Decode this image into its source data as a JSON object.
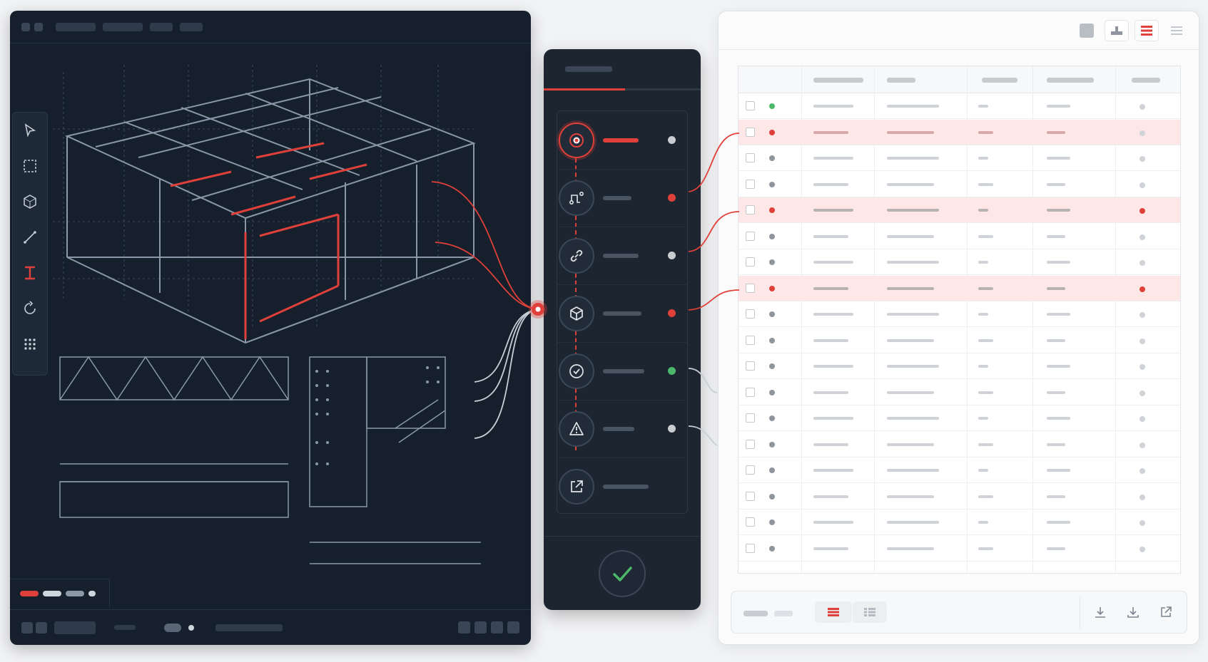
{
  "colors": {
    "accent": "#e0403a",
    "success": "#4cb86a",
    "neutral_dot": "#9aa1a9",
    "dark_bg": "#16202d",
    "panel_bg": "#1c2530"
  },
  "cad_window": {
    "tools": [
      {
        "name": "select-pointer-icon",
        "active": false
      },
      {
        "name": "marquee-select-icon",
        "active": false
      },
      {
        "name": "3d-model-icon",
        "active": false
      },
      {
        "name": "measure-line-icon",
        "active": false
      },
      {
        "name": "i-beam-member-icon",
        "active": true
      },
      {
        "name": "rotate-icon",
        "active": false
      },
      {
        "name": "grid-points-icon",
        "active": false
      }
    ]
  },
  "validation_panel": {
    "progress_fraction": 0.52,
    "steps": [
      {
        "icon": "target-icon",
        "status": "neutral",
        "active": true
      },
      {
        "icon": "path-route-icon",
        "status": "error",
        "active": false
      },
      {
        "icon": "link-icon",
        "status": "neutral",
        "active": false
      },
      {
        "icon": "cube-icon",
        "status": "error",
        "active": false
      },
      {
        "icon": "check-circle-icon",
        "status": "ok",
        "active": false
      },
      {
        "icon": "warning-icon",
        "status": "neutral",
        "active": false
      },
      {
        "icon": "export-icon",
        "status": "none",
        "active": false
      }
    ],
    "confirm_icon": "checkmark-icon"
  },
  "table_window": {
    "view_buttons": [
      "gray-square-icon",
      "align-bottom-icon",
      "list-view-icon",
      "lines-icon"
    ],
    "rows": [
      {
        "status": "ok",
        "highlight": false,
        "flag": false
      },
      {
        "status": "error",
        "highlight": true,
        "flag": false
      },
      {
        "status": "neutral",
        "highlight": false,
        "flag": false
      },
      {
        "status": "neutral",
        "highlight": false,
        "flag": false
      },
      {
        "status": "error",
        "highlight": true,
        "flag": true
      },
      {
        "status": "neutral",
        "highlight": false,
        "flag": false
      },
      {
        "status": "neutral",
        "highlight": false,
        "flag": false
      },
      {
        "status": "error",
        "highlight": true,
        "flag": true
      },
      {
        "status": "neutral",
        "highlight": false,
        "flag": false
      },
      {
        "status": "neutral",
        "highlight": false,
        "flag": false
      },
      {
        "status": "neutral",
        "highlight": false,
        "flag": false
      },
      {
        "status": "neutral",
        "highlight": false,
        "flag": false
      },
      {
        "status": "neutral",
        "highlight": false,
        "flag": false
      },
      {
        "status": "neutral",
        "highlight": false,
        "flag": false
      },
      {
        "status": "neutral",
        "highlight": false,
        "flag": false
      },
      {
        "status": "neutral",
        "highlight": false,
        "flag": false
      },
      {
        "status": "neutral",
        "highlight": false,
        "flag": false
      },
      {
        "status": "neutral",
        "highlight": false,
        "flag": false
      }
    ],
    "footer_actions": [
      "download-icon",
      "import-icon",
      "external-link-icon"
    ]
  }
}
